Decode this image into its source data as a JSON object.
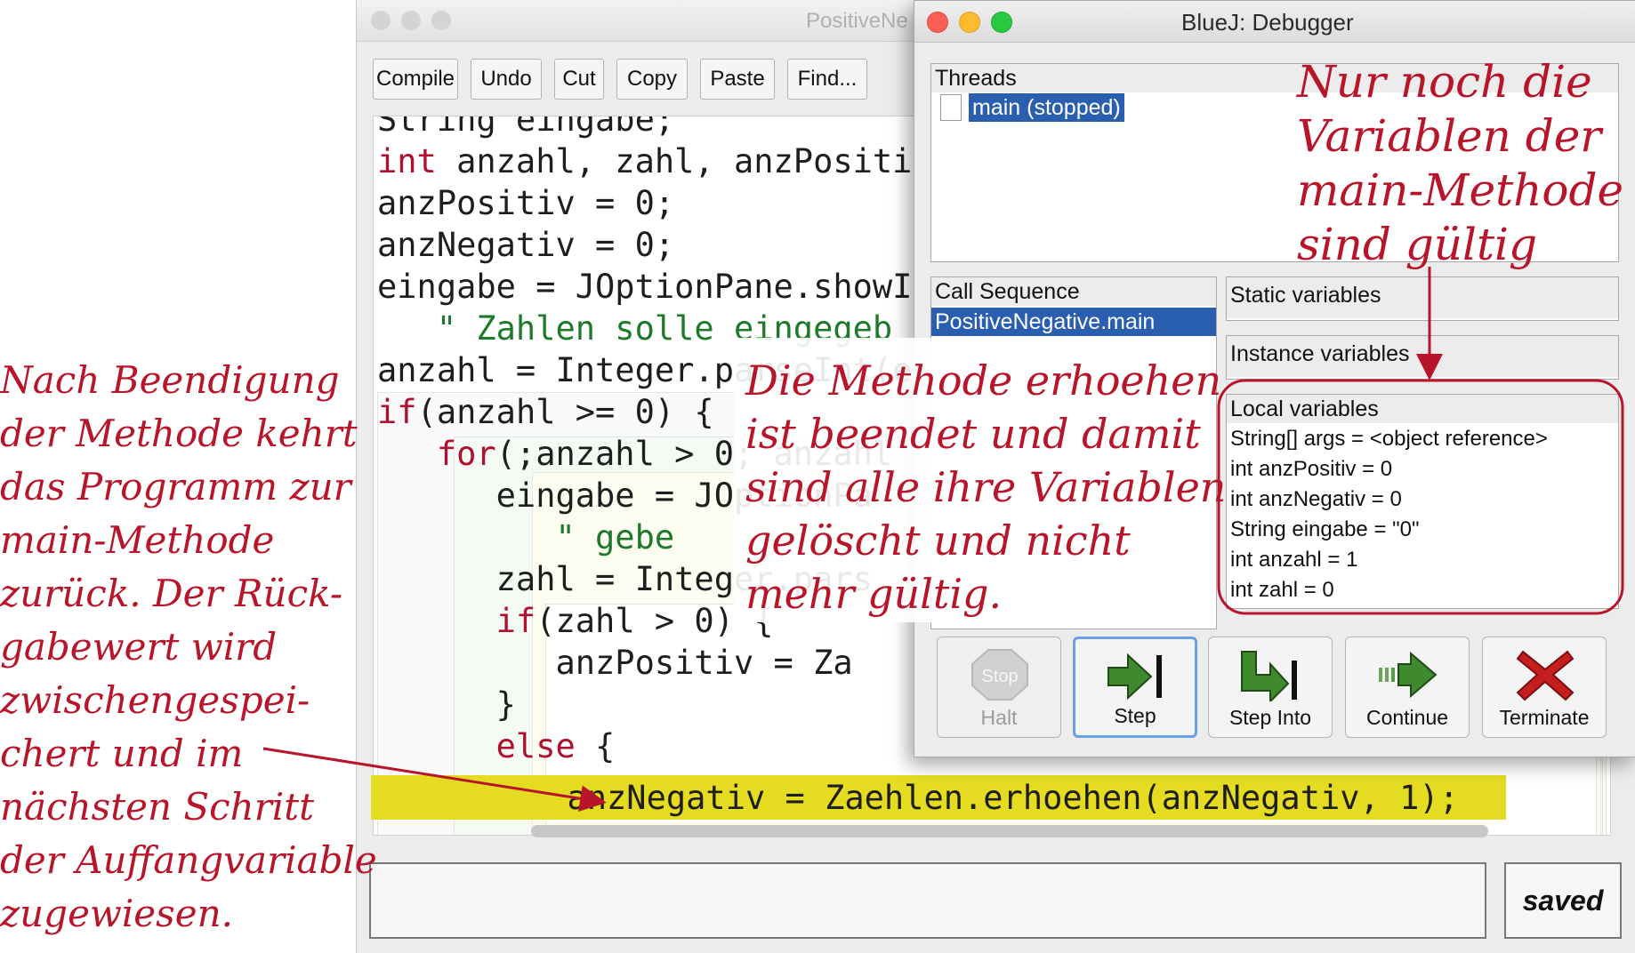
{
  "editor": {
    "title": "PositiveNe",
    "toolbar": [
      "Compile",
      "Undo",
      "Cut",
      "Copy",
      "Paste",
      "Find..."
    ],
    "code_lines": [
      {
        "parts": [
          {
            "t": "String eingabe;",
            "c": "plain"
          }
        ]
      },
      {
        "parts": [
          {
            "t": "int",
            "c": "kw"
          },
          {
            "t": " anzahl, zahl, anzPositi",
            "c": "plain"
          }
        ]
      },
      {
        "parts": [
          {
            "t": "anzPositiv = 0;",
            "c": "plain"
          }
        ]
      },
      {
        "parts": [
          {
            "t": "anzNegativ = 0;",
            "c": "plain"
          }
        ]
      },
      {
        "parts": [
          {
            "t": "eingabe = JOptionPane.showI",
            "c": "plain"
          }
        ]
      },
      {
        "parts": [
          {
            "t": "   \" Zahlen solle eingegeb",
            "c": "str"
          }
        ]
      },
      {
        "parts": [
          {
            "t": "anzahl = Integer.parseInt(e",
            "c": "plain"
          }
        ]
      },
      {
        "parts": [
          {
            "t": "if",
            "c": "kw"
          },
          {
            "t": "(anzahl >= 0) {",
            "c": "plain"
          }
        ]
      },
      {
        "parts": [
          {
            "t": "   ",
            "c": "plain"
          },
          {
            "t": "for",
            "c": "kw"
          },
          {
            "t": "(;anzahl > 0; anzahl",
            "c": "plain"
          }
        ]
      },
      {
        "parts": [
          {
            "t": "      eingabe = JOptionPa",
            "c": "plain"
          }
        ]
      },
      {
        "parts": [
          {
            "t": "         \" gebe",
            "c": "str"
          }
        ]
      },
      {
        "parts": [
          {
            "t": "      zahl = Integer.pars",
            "c": "plain"
          }
        ]
      },
      {
        "parts": [
          {
            "t": "      ",
            "c": "plain"
          },
          {
            "t": "if",
            "c": "kw"
          },
          {
            "t": "(zahl > 0) {",
            "c": "plain"
          }
        ]
      },
      {
        "parts": [
          {
            "t": "         anzPositiv = Za",
            "c": "plain"
          }
        ]
      },
      {
        "parts": [
          {
            "t": "      }",
            "c": "plain"
          }
        ]
      },
      {
        "parts": [
          {
            "t": "      ",
            "c": "plain"
          },
          {
            "t": "else",
            "c": "kw"
          },
          {
            "t": " {",
            "c": "plain"
          }
        ]
      },
      {
        "parts": [
          {
            "t": "         anzNegativ = Zaehlen.erhoehen(anzNegativ, 1);",
            "c": "plain"
          }
        ]
      }
    ],
    "status": "saved"
  },
  "debugger": {
    "title": "BlueJ:  Debugger",
    "threads_label": "Threads",
    "thread_selected": "main (stopped)",
    "call_sequence_label": "Call Sequence",
    "call_selected": "PositiveNegative.main",
    "static_label": "Static variables",
    "instance_label": "Instance variables",
    "local_label": "Local variables",
    "locals": [
      "String[] args = <object reference>",
      "int anzPositiv = 0",
      "int anzNegativ = 0",
      "String eingabe = \"0\"",
      "int anzahl = 1",
      "int zahl = 0"
    ],
    "buttons": {
      "halt": "Halt",
      "halt_icon_text": "Stop",
      "step": "Step",
      "step_into": "Step Into",
      "continue": "Continue",
      "terminate": "Terminate"
    }
  },
  "notes": {
    "top_right": [
      "Nur noch die",
      "Variablen der",
      "main-Methode",
      "sind gültig"
    ],
    "center": [
      "Die Methode erhoehen",
      "ist beendet und damit",
      "sind alle ihre Variablen",
      "gelöscht und nicht",
      "mehr gültig."
    ],
    "left": [
      "Nach Beendigung",
      "der Methode kehrt",
      "das Programm zur",
      "main-Methode",
      "zurück. Der Rück-",
      "gabewert wird",
      "zwischengespei-",
      "chert und im",
      "nächsten Schritt",
      "der Auffangvariable",
      "zugewiesen."
    ]
  },
  "colors": {
    "annotation": "#b8152a",
    "highlight": "#e5dc22",
    "selection": "#2a5fb0",
    "keyword": "#b0102e",
    "string": "#1e7a2a"
  }
}
